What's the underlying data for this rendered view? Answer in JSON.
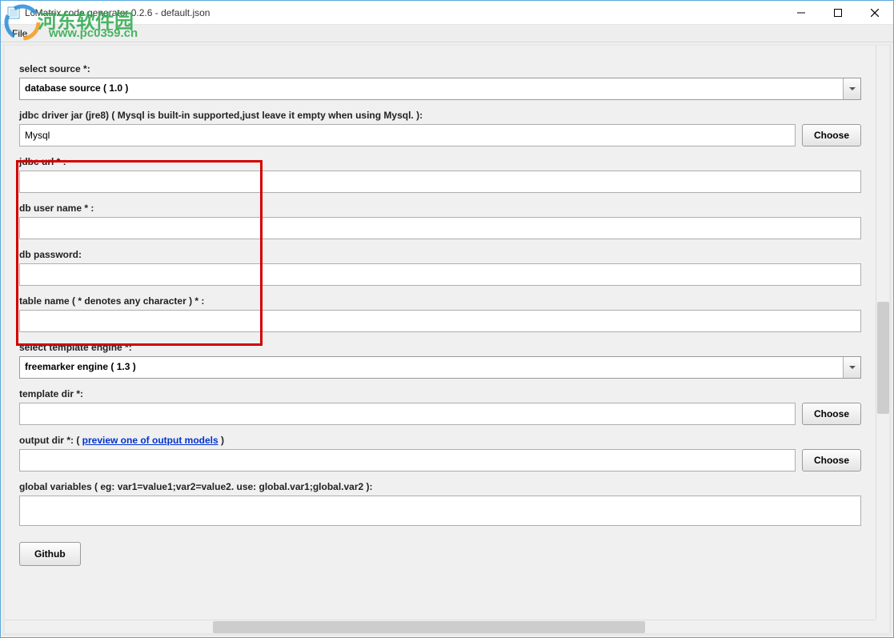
{
  "window": {
    "title": "LcMatrix code generator 0.2.6 - default.json"
  },
  "menu": {
    "file": "File"
  },
  "watermark": {
    "line1": "河东软件园",
    "line2": "www.pc0359.cn"
  },
  "labels": {
    "select_source": "select source *:",
    "jdbc_driver": "jdbc driver jar (jre8) ( Mysql is built-in supported,just leave it empty when using Mysql. ):",
    "jdbc_url": "jdbc url * :",
    "db_user": "db user name * :",
    "db_password": "db password:",
    "table_name": "table name ( * denotes any character ) * :",
    "select_engine": "select template engine *:",
    "template_dir": "template dir *:",
    "output_dir_pre": "output dir *:  ( ",
    "output_dir_link": "preview one of output models",
    "output_dir_post": " )",
    "global_vars": "global variables ( eg: var1=value1;var2=value2. use: global.var1;global.var2 ):"
  },
  "values": {
    "source_selected": "database source ( 1.0 )",
    "jdbc_driver": "Mysql",
    "jdbc_url": "",
    "db_user": "",
    "db_password": "",
    "table_name": "",
    "engine_selected": "freemarker engine ( 1.3 )",
    "template_dir": "",
    "output_dir": "",
    "global_vars": ""
  },
  "buttons": {
    "choose": "Choose",
    "github": "Github"
  }
}
